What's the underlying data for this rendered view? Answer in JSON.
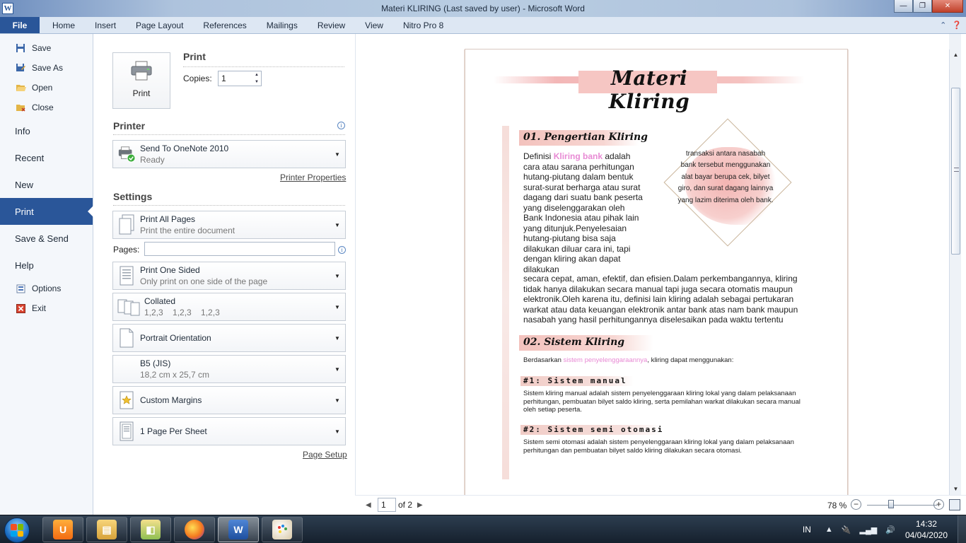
{
  "window": {
    "title": "Materi KLIRING (Last saved by user)  -  Microsoft Word",
    "app_icon_letter": "W",
    "minimize": "—",
    "maximize": "❐",
    "close": "✕"
  },
  "ribbon": {
    "file_tab": "File",
    "tabs": [
      "Home",
      "Insert",
      "Page Layout",
      "References",
      "Mailings",
      "Review",
      "View",
      "Nitro Pro 8"
    ]
  },
  "backstage": {
    "items": [
      {
        "label": "Save",
        "icon": "save-icon"
      },
      {
        "label": "Save As",
        "icon": "save-as-icon"
      },
      {
        "label": "Open",
        "icon": "open-folder-icon"
      },
      {
        "label": "Close",
        "icon": "close-folder-icon"
      },
      {
        "label": "Info"
      },
      {
        "label": "Recent"
      },
      {
        "label": "New"
      },
      {
        "label": "Print",
        "active": true
      },
      {
        "label": "Save & Send"
      },
      {
        "label": "Help"
      },
      {
        "label": "Options",
        "icon": "options-icon"
      },
      {
        "label": "Exit",
        "icon": "exit-icon"
      }
    ]
  },
  "print": {
    "button_label": "Print",
    "heading": "Print",
    "copies_label": "Copies:",
    "copies_value": "1",
    "printer_heading": "Printer",
    "printer_name": "Send To OneNote 2010",
    "printer_status": "Ready",
    "printer_properties": "Printer Properties",
    "settings_heading": "Settings",
    "print_range_main": "Print All Pages",
    "print_range_sub": "Print the entire document",
    "pages_label": "Pages:",
    "pages_value": "",
    "sided_main": "Print One Sided",
    "sided_sub": "Only print on one side of the page",
    "collate_main": "Collated",
    "collate_sub": "1,2,3    1,2,3    1,2,3",
    "orientation": "Portrait Orientation",
    "paper_main": "B5 (JIS)",
    "paper_sub": "18,2 cm x 25,7 cm",
    "margins": "Custom Margins",
    "per_sheet": "1 Page Per Sheet",
    "page_setup": "Page Setup"
  },
  "document": {
    "title": "Materi Kliring",
    "section1_heading": "01. Pengertian Kliring",
    "section1_intro": "Definisi ",
    "section1_highlight": "Kliring bank",
    "section1_col": " adalah cara atau sarana perhitungan hutang-piutang dalam bentuk surat-surat berharga atau surat dagang dari suatu bank peserta yang diselenggarakan oleh Bank Indonesia atau pihak lain yang ditunjuk.Penyelesaian hutang-piutang bisa saja dilakukan diluar cara ini, tapi dengan kliring akan dapat dilakukan",
    "section1_full": "secara cepat, aman, efektif, dan efisien.Dalam perkembangannya, kliring tidak hanya dilakukan secara manual tapi juga secara otomatis maupun elektronik.Oleh karena itu, definisi lain kliring adalah sebagai pertukaran warkat atau data keuangan elektronik antar bank atas nam bank maupun nasabah yang hasil perhitungannya diselesaikan pada waktu tertentu",
    "callout": "transaksi antara nasabah bank tersebut menggunakan alat bayar berupa cek, bilyet giro, dan surat dagang lainnya yang lazim diterima oleh bank.",
    "section2_heading": "02. Sistem Kliring",
    "section2_intro": "Berdasarkan ",
    "section2_highlight": "sistem penyelenggaraannya",
    "section2_rest": ", kliring dapat menggunakan:",
    "sub1_heading": "#1: Sistem manual",
    "sub1_text": "Sistem kliring manual adalah sistem penyelenggaraan kliring lokal yang dalam pelaksanaan perhitungan, pembuatan bilyet saldo kliring, serta pemilahan warkat dilakukan secara manual oleh setiap peserta.",
    "sub2_heading": "#2: Sistem semi otomasi",
    "sub2_text": "Sistem semi otomasi adalah sistem penyelenggaraan kliring lokal yang dalam pelaksanaan perhitungan dan pembuatan bilyet saldo kliring dilakukan secara otomasi."
  },
  "navigator": {
    "page_value": "1",
    "of_text": "of 2",
    "zoom": "78 %"
  },
  "taskbar": {
    "apps": [
      "uc-browser",
      "file-explorer",
      "folder-windows",
      "firefox",
      "microsoft-word",
      "paint"
    ],
    "language": "IN",
    "time": "14:32",
    "date": "04/04/2020"
  },
  "colors": {
    "accent_blue": "#2a5699",
    "highlight_pink": "#e88ad4",
    "title_band": "#f6c6c3"
  }
}
